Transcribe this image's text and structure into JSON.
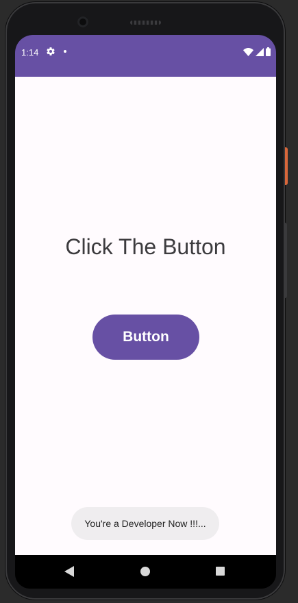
{
  "status_bar": {
    "time": "1:14",
    "background_color": "#6750a4",
    "icons": [
      "gear-icon",
      "notification-dot-icon",
      "wifi-icon",
      "signal-icon",
      "battery-icon"
    ]
  },
  "main": {
    "headline": "Click The Button",
    "button_label": "Button",
    "button_color": "#6750a4",
    "background_color": "#fffbfe"
  },
  "toast": {
    "message": "You're a Developer Now !!!..."
  },
  "nav_bar": {
    "icons": [
      "back-icon",
      "home-icon",
      "recents-icon"
    ]
  }
}
